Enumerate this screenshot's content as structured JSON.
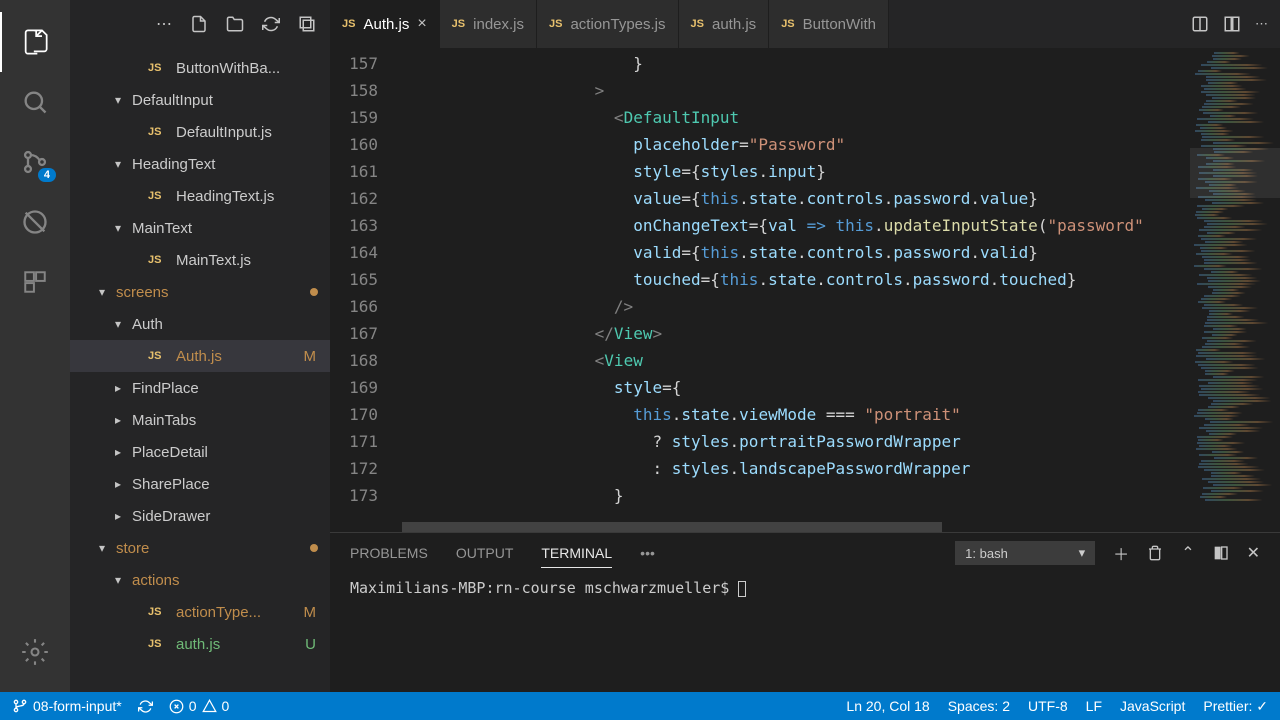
{
  "activity": {
    "scm_badge": "4"
  },
  "sidebar": {
    "items": [
      {
        "type": "file",
        "name": "ButtonWithBa...",
        "indent": 3,
        "icon": "js"
      },
      {
        "type": "folder",
        "name": "DefaultInput",
        "indent": 2,
        "open": true
      },
      {
        "type": "file",
        "name": "DefaultInput.js",
        "indent": 3,
        "icon": "js"
      },
      {
        "type": "folder",
        "name": "HeadingText",
        "indent": 2,
        "open": true
      },
      {
        "type": "file",
        "name": "HeadingText.js",
        "indent": 3,
        "icon": "js"
      },
      {
        "type": "folder",
        "name": "MainText",
        "indent": 2,
        "open": true
      },
      {
        "type": "file",
        "name": "MainText.js",
        "indent": 3,
        "icon": "js"
      },
      {
        "type": "folder",
        "name": "screens",
        "indent": 1,
        "open": true,
        "dot": true,
        "mod": true
      },
      {
        "type": "folder",
        "name": "Auth",
        "indent": 2,
        "open": true
      },
      {
        "type": "file",
        "name": "Auth.js",
        "indent": 3,
        "icon": "js",
        "badge": "M",
        "selected": true,
        "mod": true
      },
      {
        "type": "folder",
        "name": "FindPlace",
        "indent": 2,
        "open": false
      },
      {
        "type": "folder",
        "name": "MainTabs",
        "indent": 2,
        "open": false
      },
      {
        "type": "folder",
        "name": "PlaceDetail",
        "indent": 2,
        "open": false
      },
      {
        "type": "folder",
        "name": "SharePlace",
        "indent": 2,
        "open": false
      },
      {
        "type": "folder",
        "name": "SideDrawer",
        "indent": 2,
        "open": false
      },
      {
        "type": "folder",
        "name": "store",
        "indent": 1,
        "open": true,
        "dot": true,
        "mod": true
      },
      {
        "type": "folder",
        "name": "actions",
        "indent": 2,
        "open": true,
        "mod": true
      },
      {
        "type": "file",
        "name": "actionType...",
        "indent": 3,
        "icon": "js",
        "badge": "M",
        "mod": true
      },
      {
        "type": "file",
        "name": "auth.js",
        "indent": 3,
        "icon": "js",
        "badge": "U",
        "untracked": true
      }
    ]
  },
  "tabs": [
    {
      "name": "Auth.js",
      "icon": "js",
      "active": true,
      "close": true
    },
    {
      "name": "index.js",
      "icon": "js"
    },
    {
      "name": "actionTypes.js",
      "icon": "js"
    },
    {
      "name": "auth.js",
      "icon": "js"
    },
    {
      "name": "ButtonWith",
      "icon": "js"
    }
  ],
  "editor": {
    "lines": [
      157,
      158,
      159,
      160,
      161,
      162,
      163,
      164,
      165,
      166,
      167,
      168,
      169,
      170,
      171,
      172,
      173
    ],
    "code": {
      "l157": "            }",
      "l158": "          >",
      "l159_pre": "            <",
      "l159_tag": "DefaultInput",
      "l160_attr": "placeholder",
      "l160_val": "\"Password\"",
      "l161_attr": "style",
      "l161_val": "styles",
      "l161_prop": "input",
      "l162_attr": "value",
      "l162_expr": "this.state.controls.password.value",
      "l163_attr": "onChangeText",
      "l163_param": "val",
      "l163_func": "updateInputState",
      "l163_arg": "\"password\"",
      "l164_attr": "valid",
      "l164_expr": "this.state.controls.password.valid",
      "l165_attr": "touched",
      "l165_expr": "this.state.controls.password.touched",
      "l166": "            />",
      "l167_close": "View",
      "l168_open": "View",
      "l169_attr": "style",
      "l170_expr": "this.state.viewMode",
      "l170_eq": " === ",
      "l170_str": "\"portrait\"",
      "l171_q": "? ",
      "l171_val": "styles.portraitPasswordWrapper",
      "l172_q": ": ",
      "l172_val": "styles.landscapePasswordWrapper",
      "l173": "            }"
    }
  },
  "panel": {
    "tabs": {
      "problems": "PROBLEMS",
      "output": "OUTPUT",
      "terminal": "TERMINAL"
    },
    "select_label": "1: bash",
    "terminal_prompt": "Maximilians-MBP:rn-course mschwarzmueller$ "
  },
  "status": {
    "branch": "08-form-input*",
    "errors": "0",
    "warnings": "0",
    "cursor": "Ln 20, Col 18",
    "spaces": "Spaces: 2",
    "encoding": "UTF-8",
    "eol": "LF",
    "lang": "JavaScript",
    "prettier": "Prettier: ✓"
  }
}
